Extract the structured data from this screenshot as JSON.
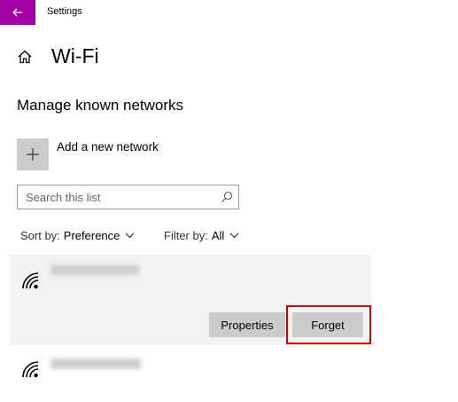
{
  "window": {
    "title": "Settings",
    "accent_color": "#a400a4",
    "back_icon": "back-arrow-icon"
  },
  "header": {
    "home_icon": "home-icon",
    "title": "Wi-Fi"
  },
  "section": {
    "title": "Manage known networks"
  },
  "add_network": {
    "icon": "plus-icon",
    "label": "Add a new network"
  },
  "search": {
    "placeholder": "Search this list",
    "value": "",
    "icon": "search-icon"
  },
  "sort": {
    "label": "Sort by:",
    "value": "Preference"
  },
  "filter": {
    "label": "Filter by:",
    "value": "All"
  },
  "networks": [
    {
      "icon": "wifi-icon",
      "selected": true,
      "actions": {
        "properties_label": "Properties",
        "forget_label": "Forget"
      }
    },
    {
      "icon": "wifi-icon",
      "selected": false
    }
  ],
  "highlight_color": "#d10000"
}
